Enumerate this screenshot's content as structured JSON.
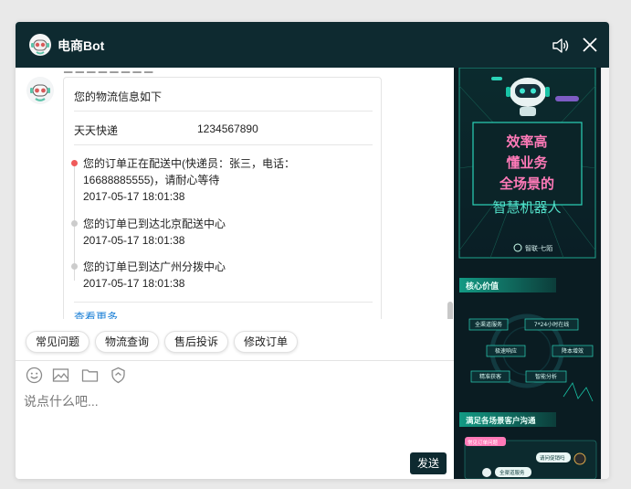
{
  "window": {
    "title": "电商Bot"
  },
  "chat": {
    "message": {
      "title": "您的物流信息如下",
      "company": "天天快递",
      "tracking_no": "1234567890",
      "events": [
        {
          "text": "您的订单正在配送中(快递员：张三，电话：16688885555)，请耐心等待",
          "time": "2017-05-17 18:01:38",
          "active": true
        },
        {
          "text": "您的订单已到达北京配送中心",
          "time": "2017-05-17 18:01:38",
          "active": false
        },
        {
          "text": "您的订单已到达广州分拨中心",
          "time": "2017-05-17 18:01:38",
          "active": false
        }
      ],
      "more_label": "查看更多"
    }
  },
  "quick_replies": [
    "常见问题",
    "物流查询",
    "售后投诉",
    "修改订单"
  ],
  "input": {
    "placeholder": "说点什么吧...",
    "send_label": "发送"
  },
  "promo": {
    "headline": [
      "效率高",
      "懂业务",
      "全场景的",
      "智慧机器人"
    ],
    "brand": "智联·七陌",
    "section1_title": "核心价值",
    "values": [
      "全渠道服务",
      "7*24小时在线",
      "极速响应",
      "降本增效",
      "精准获客",
      "智能分析"
    ],
    "section2_title": "满足各场景客户沟通",
    "chat_tags": [
      "常见订单问题",
      "请问促销吗",
      "全渠道服务"
    ]
  },
  "colors": {
    "titlebar": "#0e2a30",
    "accent_teal": "#19c3a6",
    "alert_dot": "#ef5a5a",
    "link": "#1a7fd6",
    "promo_pink": "#ff7ab8"
  }
}
